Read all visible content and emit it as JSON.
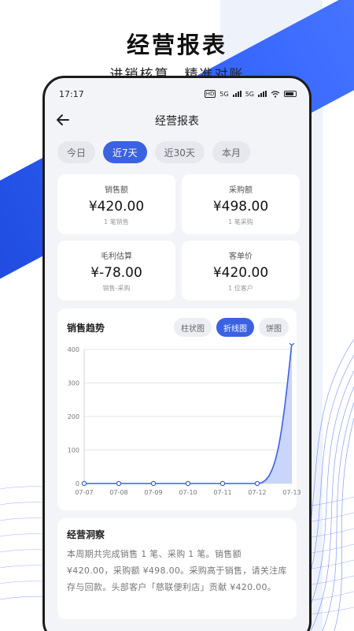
{
  "promo": {
    "title": "经营报表",
    "subtitle": "进销核算　精准对账"
  },
  "status_bar": {
    "time": "17:17",
    "hd_label": "HD",
    "net1": "5G",
    "net2": "5G"
  },
  "header": {
    "title": "经营报表",
    "back_icon": "arrow-left-icon"
  },
  "range_tabs": [
    {
      "label": "今日",
      "active": false
    },
    {
      "label": "近7天",
      "active": true
    },
    {
      "label": "近30天",
      "active": false
    },
    {
      "label": "本月",
      "active": false
    }
  ],
  "stats": [
    {
      "label": "销售额",
      "value": "¥420.00",
      "sub": "1 笔销售"
    },
    {
      "label": "采购额",
      "value": "¥498.00",
      "sub": "1 笔采购"
    },
    {
      "label": "毛利估算",
      "value": "¥-78.00",
      "sub": "销售-采购"
    },
    {
      "label": "客单价",
      "value": "¥420.00",
      "sub": "1 位客户"
    }
  ],
  "trend": {
    "title": "销售趋势",
    "chart_types": [
      {
        "label": "柱状图",
        "active": false
      },
      {
        "label": "折线图",
        "active": true
      },
      {
        "label": "饼图",
        "active": false
      }
    ]
  },
  "chart_data": {
    "type": "area",
    "categories": [
      "07-07",
      "07-08",
      "07-09",
      "07-10",
      "07-11",
      "07-12",
      "07-13"
    ],
    "values": [
      0,
      0,
      0,
      0,
      0,
      0,
      420
    ],
    "ylim": [
      0,
      400
    ],
    "yticks": [
      0,
      100,
      200,
      300,
      400
    ],
    "grid": true,
    "color": "#3b62e0",
    "fill": "#c9d5fa"
  },
  "insight": {
    "title": "经营洞察",
    "text": "本周期共完成销售 1 笔、采购 1 笔。销售额 ¥420.00，采购额 ¥498.00。采购高于销售，请关注库存与回款。头部客户「慈联便利店」贡献 ¥420.00。"
  },
  "colors": {
    "accent": "#3b62e0",
    "background": "#f3f4f8",
    "band": "#2f5bf0"
  }
}
